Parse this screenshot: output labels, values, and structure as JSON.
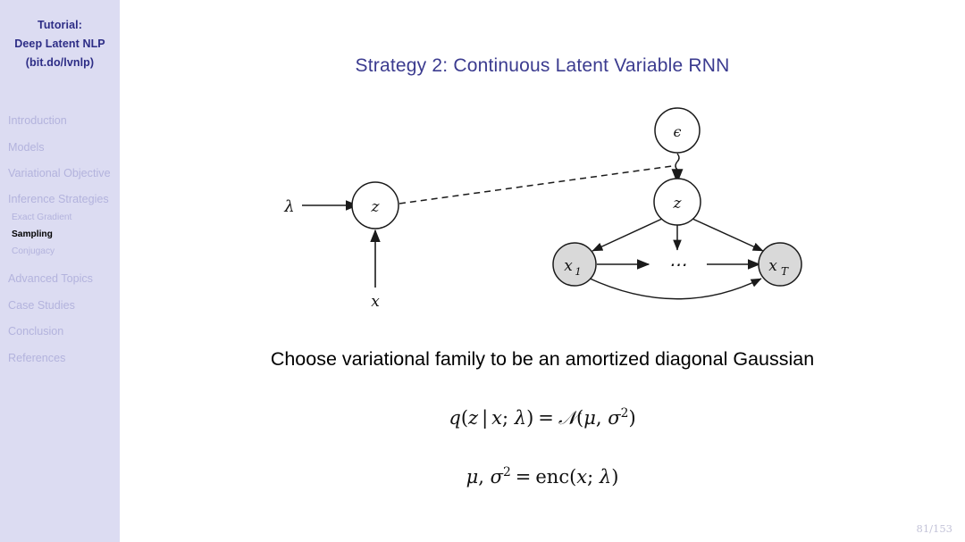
{
  "sidebar": {
    "title_lines": [
      "Tutorial:",
      "Deep Latent NLP",
      "(bit.do/lvnlp)"
    ],
    "sections": [
      {
        "label": "Introduction",
        "active": false
      },
      {
        "label": "Models",
        "active": false
      },
      {
        "label": "Variational Objective",
        "active": false
      },
      {
        "label": "Inference Strategies",
        "active": false
      }
    ],
    "subitems": [
      {
        "label": "Exact Gradient",
        "active": false
      },
      {
        "label": "Sampling",
        "active": true
      },
      {
        "label": "Conjugacy",
        "active": false
      }
    ],
    "sections_after": [
      {
        "label": "Advanced Topics",
        "active": false
      },
      {
        "label": "Case Studies",
        "active": false
      },
      {
        "label": "Conclusion",
        "active": false
      },
      {
        "label": "References",
        "active": false
      }
    ],
    "colors": {
      "background": "#dcdcf2",
      "title": "#2d2d86",
      "inactive": "#b3b3dd",
      "active": "#000000"
    }
  },
  "main": {
    "title": "Strategy 2:  Continuous Latent Variable RNN",
    "title_color": "#3b3b8f",
    "body_text": "Choose variational family to be an amortized diagonal Gaussian",
    "equations": [
      {
        "id": "eq1",
        "plain": "q(z | x; λ) = ᵊ(μ, σ²)",
        "parts": {
          "q": "q",
          "lparen": "(",
          "z": "z",
          "bar": "|",
          "x": "x",
          "semi": ";",
          "lambda": "λ",
          "rparen": ")",
          "eq": "=",
          "cal_n": "𝒩",
          "lparen2": "(",
          "mu": "μ",
          "comma": ",",
          "sigma": "σ",
          "exp": "2",
          "rparen2": ")"
        }
      },
      {
        "id": "eq2",
        "plain": "μ, σ² = enc(x; λ)",
        "parts": {
          "mu": "μ",
          "comma": ",",
          "sigma": "σ",
          "exp": "2",
          "eq": "=",
          "enc": "enc",
          "lparen": "(",
          "x": "x",
          "semi": ";",
          "lambda": "λ",
          "rparen": ")"
        }
      }
    ],
    "page_number": "81/153"
  },
  "diagram": {
    "nodes": {
      "epsilon": {
        "label": "ϵ",
        "fill": "#ffffff"
      },
      "z_left": {
        "label": "z",
        "fill": "#ffffff"
      },
      "z_right": {
        "label": "z",
        "fill": "#ffffff"
      },
      "x1": {
        "label": "x",
        "sub": "1",
        "fill": "#d9d9d9"
      },
      "xT": {
        "label": "x",
        "sub": "T",
        "fill": "#d9d9d9"
      }
    },
    "labels": {
      "lambda": "λ",
      "x_input": "x",
      "ellipsis": "⋯"
    },
    "edge_color": "#1a1a1a",
    "node_stroke": "#1a1a1a"
  }
}
